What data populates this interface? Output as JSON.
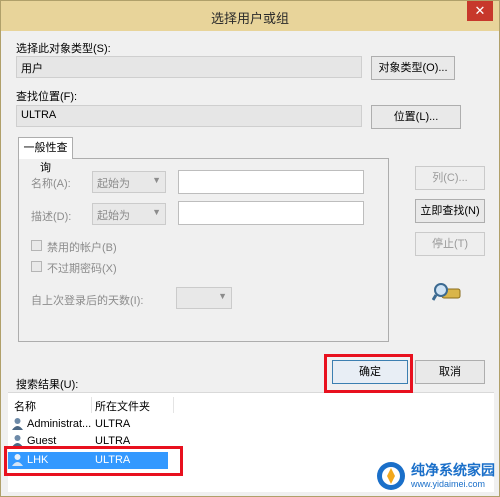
{
  "window": {
    "title": "选择用户或组",
    "close_glyph": "✕"
  },
  "object_type": {
    "label": "选择此对象类型(S):",
    "value": "用户",
    "button": "对象类型(O)..."
  },
  "location": {
    "label": "查找位置(F):",
    "value": "ULTRA",
    "button": "位置(L)..."
  },
  "general_query": {
    "tab": "一般性查询",
    "name_label": "名称(A):",
    "name_mode": "起始为",
    "desc_label": "描述(D):",
    "desc_mode": "起始为",
    "disabled_accounts": "禁用的帐户(B)",
    "no_expire_password": "不过期密码(X)",
    "days_since_logon": "自上次登录后的天数(I):"
  },
  "actions": {
    "columns": "列(C)...",
    "find_now": "立即查找(N)",
    "stop": "停止(T)",
    "ok": "确定",
    "cancel": "取消"
  },
  "results": {
    "label": "搜索结果(U):",
    "headers": [
      "名称",
      "所在文件夹"
    ],
    "rows": [
      {
        "name": "Administrat...",
        "folder": "ULTRA"
      },
      {
        "name": "Guest",
        "folder": "ULTRA"
      },
      {
        "name": "LHK",
        "folder": "ULTRA"
      }
    ]
  },
  "watermark": {
    "text": "纯净系统家园",
    "url": "www.yidaimei.com"
  },
  "colors": {
    "titlebar": "#e8d49a",
    "selection": "#3399ff",
    "highlight_box": "#e8101e",
    "close": "#c7382b"
  }
}
